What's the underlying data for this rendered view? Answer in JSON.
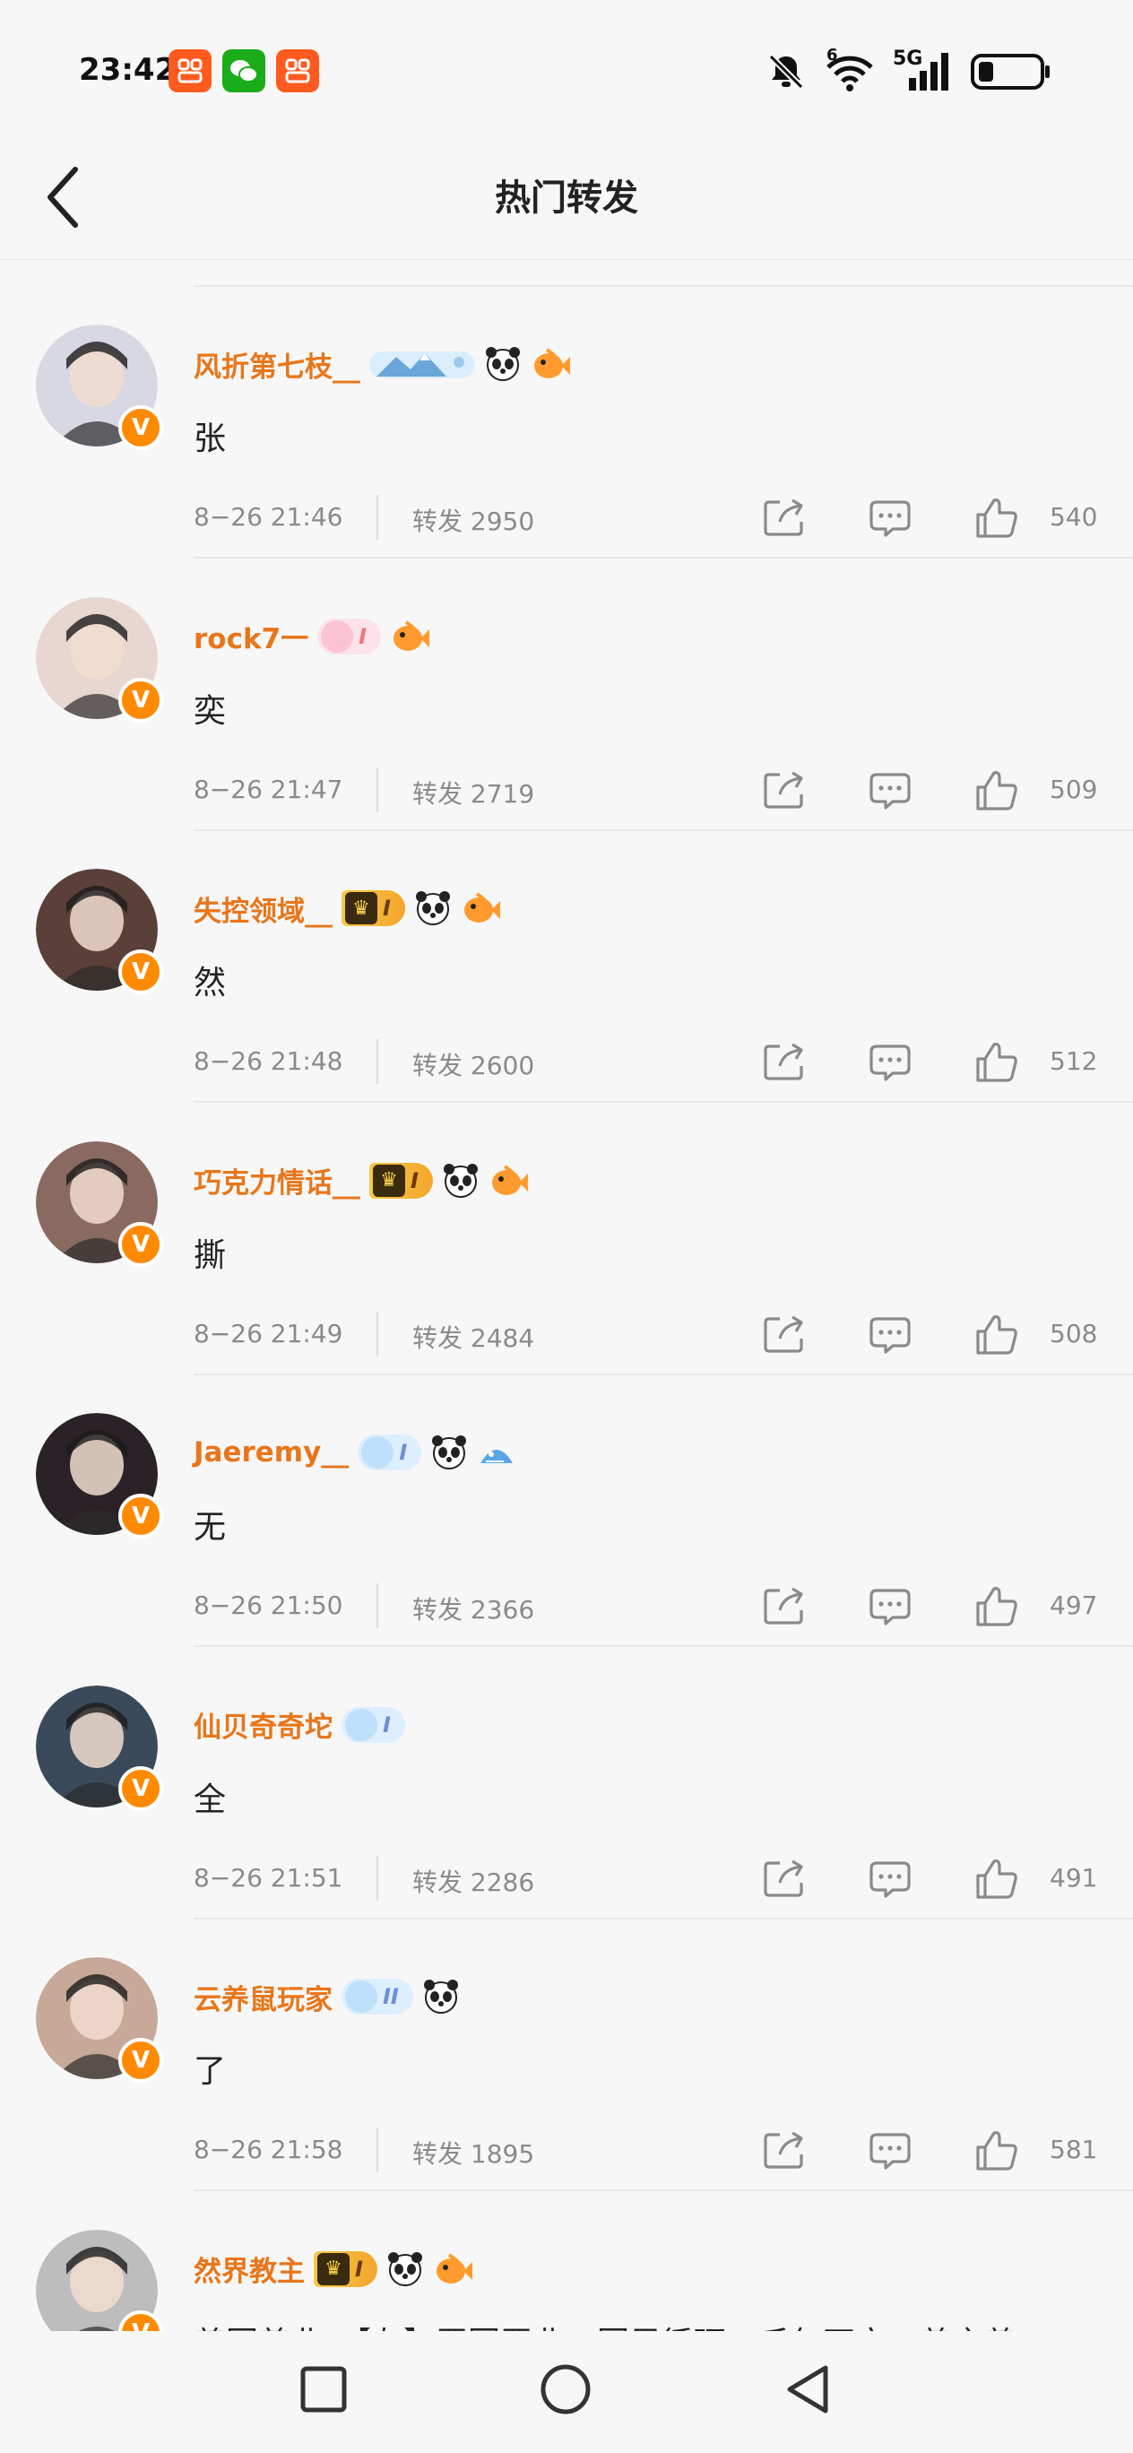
{
  "status_bar": {
    "time": "23:42",
    "network_label": "5G",
    "wifi_label": "6"
  },
  "header": {
    "title": "热门转发"
  },
  "colors": {
    "username": "#e8761a",
    "verified": "#ff8a00",
    "meta": "#8a8a8a"
  },
  "items": [
    {
      "username": "风折第七枝__",
      "comment": "张",
      "date": "8−26  21:46",
      "repost": "转发  2950",
      "likes": "540",
      "avatar_color": "#d8d8e4"
    },
    {
      "username": "rock7一",
      "comment": "奕",
      "date": "8−26  21:47",
      "repost": "转发  2719",
      "likes": "509",
      "avatar_color": "#e8d6d0"
    },
    {
      "username": "失控领域__",
      "comment": "然",
      "date": "8−26  21:48",
      "repost": "转发  2600",
      "likes": "512",
      "avatar_color": "#5a4038",
      "badge_level": "I"
    },
    {
      "username": "巧克力情话__",
      "comment": "撕",
      "date": "8−26  21:49",
      "repost": "转发  2484",
      "likes": "508",
      "avatar_color": "#8a6a60",
      "badge_level": "I"
    },
    {
      "username": "Jaeremy__",
      "comment": "无",
      "date": "8−26  21:50",
      "repost": "转发  2366",
      "likes": "497",
      "avatar_color": "#2a2226"
    },
    {
      "username": "仙贝奇奇坨",
      "comment": "全",
      "date": "8−26  21:51",
      "repost": "转发  2286",
      "likes": "491",
      "avatar_color": "#3a4a5a"
    },
    {
      "username": "云养鼠玩家",
      "comment": "了",
      "date": "8−26  21:58",
      "repost": "转发  1895",
      "likes": "581",
      "avatar_color": "#c8a898",
      "badge_level": "II"
    },
    {
      "username": "然界教主",
      "comment": "善因善业、【左】恶因恶业、因果循环、千年不空。善言善",
      "date": "",
      "repost": "",
      "likes": "",
      "avatar_color": "#bdbdbd",
      "badge_level": "I"
    }
  ],
  "icons": {
    "back": "chevron-left-icon",
    "share": "share-icon",
    "comment": "comment-icon",
    "like": "thumbs-up-icon",
    "verified": "verified-v-icon"
  }
}
